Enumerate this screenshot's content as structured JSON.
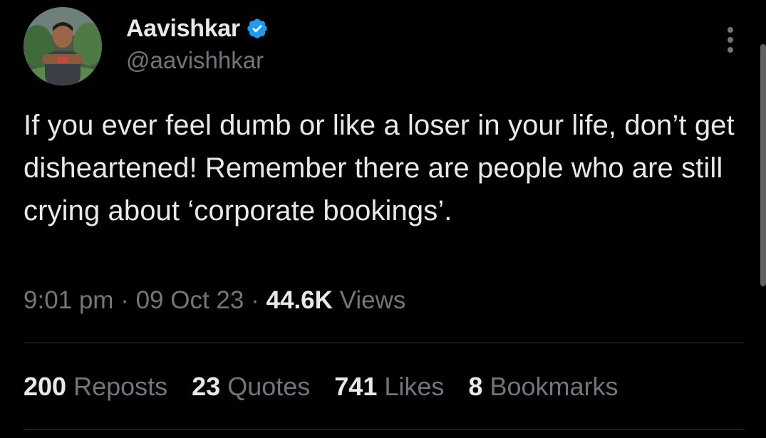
{
  "user": {
    "display_name": "Aavishkar",
    "handle": "@aavishhkar",
    "verified": true,
    "verified_color": "#1d9bf0"
  },
  "tweet": {
    "text": "If you ever feel dumb or like a loser in your life, don’t get disheartened! Remember there are people who are still crying about ‘corporate bookings’.",
    "time": "9:01 pm",
    "date": "09 Oct 23",
    "views_count": "44.6K",
    "views_label": "Views",
    "separator": "·"
  },
  "stats": [
    {
      "count": "200",
      "label": "Reposts"
    },
    {
      "count": "23",
      "label": "Quotes"
    },
    {
      "count": "741",
      "label": "Likes"
    },
    {
      "count": "8",
      "label": "Bookmarks"
    }
  ],
  "icons": {
    "more": "more-icon",
    "verified": "verified-badge-icon"
  },
  "colors": {
    "background": "#000000",
    "text_primary": "#e7e9ea",
    "text_secondary": "#71767b",
    "divider": "#2f3336"
  }
}
